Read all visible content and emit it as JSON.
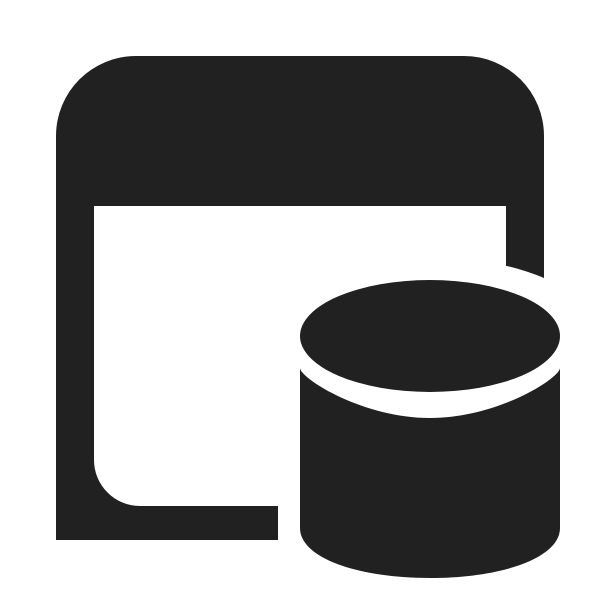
{
  "icon": {
    "name": "window-database-icon",
    "color": "#212121",
    "background": "#ffffff"
  }
}
